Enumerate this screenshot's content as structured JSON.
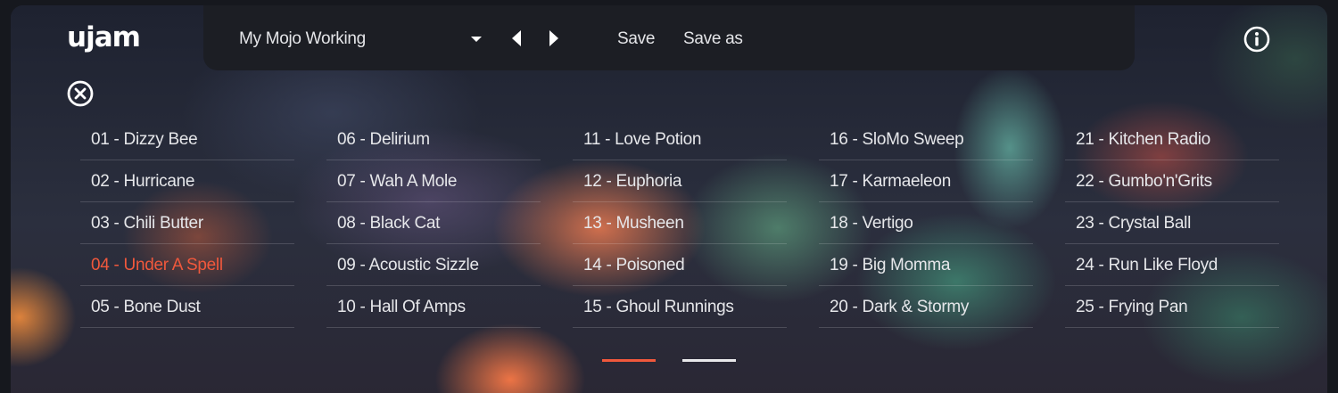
{
  "header": {
    "logo": "ujam",
    "preset_name": "My Mojo Working",
    "save_label": "Save",
    "save_as_label": "Save as"
  },
  "presets": {
    "columns": [
      [
        "01 - Dizzy Bee",
        "02 - Hurricane",
        "03 - Chili Butter",
        "04 - Under A Spell",
        "05 - Bone Dust"
      ],
      [
        "06 - Delirium",
        "07 - Wah A Mole",
        "08 - Black Cat",
        "09 - Acoustic Sizzle",
        "10 - Hall Of Amps"
      ],
      [
        "11 - Love Potion",
        "12 - Euphoria",
        "13 - Musheen",
        "14 - Poisoned",
        "15 - Ghoul Runnings"
      ],
      [
        "16 - SloMo Sweep",
        "17 - Karmaeleon",
        "18 - Vertigo",
        "19 - Big Momma",
        "20 - Dark & Stormy"
      ],
      [
        "21 - Kitchen Radio",
        "22 - Gumbo'n'Grits",
        "23 - Crystal Ball",
        "24 - Run Like Floyd",
        "25 - Frying Pan"
      ]
    ],
    "selected": "04 - Under A Spell"
  },
  "pagination": {
    "pages": 2,
    "current": 1
  },
  "colors": {
    "accent": "#f0583c",
    "text": "#e6e7ea",
    "page_inactive": "#e8e8ea"
  }
}
